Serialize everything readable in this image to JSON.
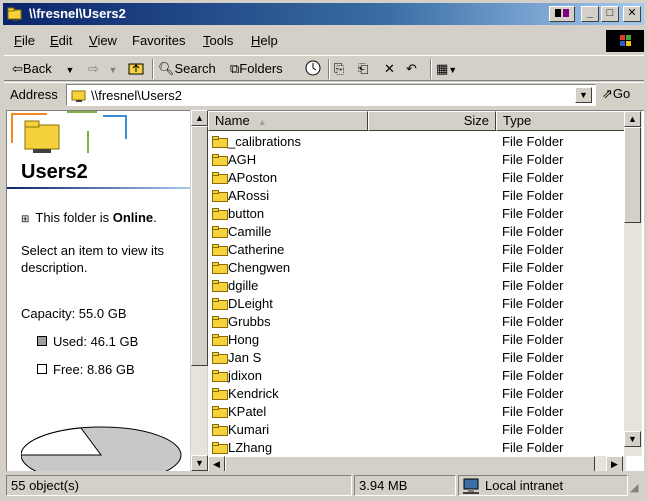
{
  "window": {
    "title": "\\\\fresnel\\Users2"
  },
  "menu": [
    {
      "label": "File",
      "key": "F",
      "rest": "ile"
    },
    {
      "label": "Edit",
      "key": "E",
      "rest": "dit"
    },
    {
      "label": "View",
      "key": "V",
      "rest": "iew"
    },
    {
      "label": "Favorites",
      "key": "",
      "rest": "Favorites"
    },
    {
      "label": "Tools",
      "key": "T",
      "rest": "ools"
    },
    {
      "label": "Help",
      "key": "H",
      "rest": "elp"
    }
  ],
  "toolbar": {
    "back_label": "Back",
    "search_label": "Search",
    "folders_label": "Folders"
  },
  "address": {
    "label": "Address",
    "value": "\\\\fresnel\\Users2",
    "go_label": "Go"
  },
  "left_pane": {
    "title": "Users2",
    "online_prefix": "This folder is ",
    "online_status": "Online",
    "online_suffix": ".",
    "select_hint": "Select an item to view its description.",
    "capacity": "Capacity: 55.0 GB",
    "used": "Used: 46.1 GB",
    "free": "Free: 8.86 GB",
    "used_fraction": 0.838
  },
  "columns": {
    "name": "Name",
    "size": "Size",
    "type": "Type"
  },
  "files": [
    {
      "name": "_calibrations",
      "type": "File Folder"
    },
    {
      "name": "AGH",
      "type": "File Folder"
    },
    {
      "name": "APoston",
      "type": "File Folder"
    },
    {
      "name": "ARossi",
      "type": "File Folder"
    },
    {
      "name": "button",
      "type": "File Folder"
    },
    {
      "name": "Camille",
      "type": "File Folder"
    },
    {
      "name": "Catherine",
      "type": "File Folder"
    },
    {
      "name": "Chengwen",
      "type": "File Folder"
    },
    {
      "name": "dgille",
      "type": "File Folder"
    },
    {
      "name": "DLeight",
      "type": "File Folder"
    },
    {
      "name": "Grubbs",
      "type": "File Folder"
    },
    {
      "name": "Hong",
      "type": "File Folder"
    },
    {
      "name": "Jan S",
      "type": "File Folder"
    },
    {
      "name": "jdixon",
      "type": "File Folder"
    },
    {
      "name": "Kendrick",
      "type": "File Folder"
    },
    {
      "name": "KPatel",
      "type": "File Folder"
    },
    {
      "name": "Kumari",
      "type": "File Folder"
    },
    {
      "name": "LZhang",
      "type": "File Folder"
    }
  ],
  "status": {
    "objects": "55 object(s)",
    "size": "3.94 MB",
    "zone": "Local intranet"
  },
  "colors": {
    "title_active": "#0a246a",
    "window_face": "#d4d0c8",
    "folder_yellow": "#f5d23c"
  }
}
